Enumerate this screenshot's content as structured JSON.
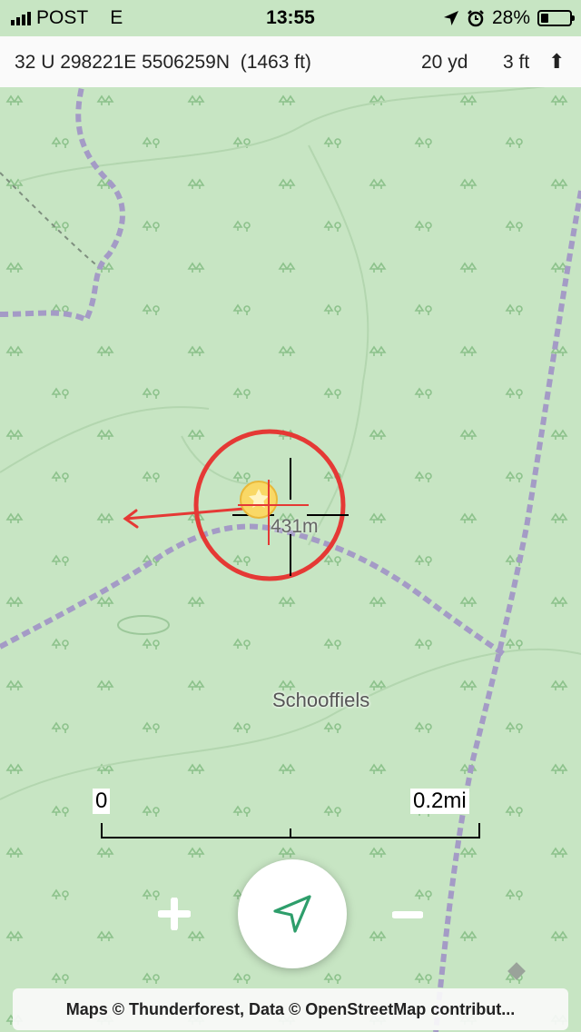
{
  "status_bar": {
    "carrier": "POST",
    "network": "E",
    "time": "13:55",
    "battery": "28%",
    "battery_level": 0.28
  },
  "info_bar": {
    "coordinates": "32 U 298221E 5506259N",
    "elevation": "(1463 ft)",
    "accuracy": "20 yd",
    "altitude_accuracy": "3 ft",
    "arrow": "⬆"
  },
  "map": {
    "place_label": "Schooffiels",
    "target_distance": "431m",
    "marker_icon": "star-marker-icon",
    "accent_color": "#e53935",
    "trail_color": "#a49bc6",
    "map_bg_color": "#c7e5c3"
  },
  "scale": {
    "start_label": "0",
    "end_label": "0.2mi"
  },
  "controls": {
    "zoom_in": "zoom-in-icon",
    "zoom_out": "zoom-out-icon",
    "locate": "location-arrow-icon"
  },
  "attribution": {
    "text": "Maps © Thunderforest, Data © OpenStreetMap contribut..."
  }
}
